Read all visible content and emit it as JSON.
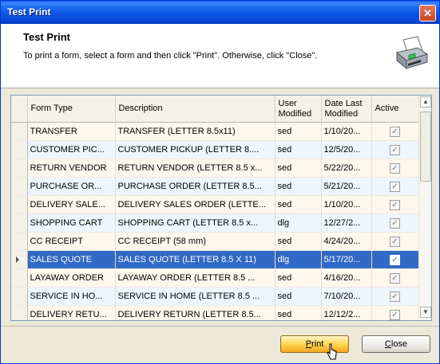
{
  "window": {
    "title": "Test Print",
    "close_glyph": "✕"
  },
  "header": {
    "title": "Test Print",
    "description": "To print a form, select a form and then click \"Print\".  Otherwise, click \"Close\".",
    "icon": "printer-icon"
  },
  "grid": {
    "columns": [
      "Form Type",
      "Description",
      "User Modified",
      "Date Last Modified",
      "Active"
    ],
    "rows": [
      {
        "form_type": "TRANSFER",
        "description": "TRANSFER (LETTER 8.5x11)",
        "user": "sed",
        "date": "1/10/20...",
        "active": true
      },
      {
        "form_type": "CUSTOMER PIC...",
        "description": "CUSTOMER PICKUP (LETTER 8....",
        "user": "sed",
        "date": "12/5/20...",
        "active": true
      },
      {
        "form_type": "RETURN VENDOR",
        "description": "RETURN VENDOR (LETTER 8.5 x...",
        "user": "sed",
        "date": "5/22/20...",
        "active": true
      },
      {
        "form_type": "PURCHASE OR...",
        "description": "PURCHASE ORDER (LETTER 8.5...",
        "user": "sed",
        "date": "5/21/20...",
        "active": true
      },
      {
        "form_type": "DELIVERY SALE...",
        "description": "DELIVERY SALES ORDER (LETTE...",
        "user": "sed",
        "date": "1/10/20...",
        "active": true
      },
      {
        "form_type": "SHOPPING CART",
        "description": "SHOPPING CART (LETTER 8.5 x...",
        "user": "dlg",
        "date": "12/27/2...",
        "active": true
      },
      {
        "form_type": "CC RECEIPT",
        "description": "CC RECEIPT (58 mm)",
        "user": "sed",
        "date": "4/24/20...",
        "active": true
      },
      {
        "form_type": "SALES QUOTE",
        "description": "SALES QUOTE (LETTER 8.5 X 11)",
        "user": "dlg",
        "date": "5/17/20...",
        "active": true,
        "selected": true
      },
      {
        "form_type": "LAYAWAY ORDER",
        "description": "LAYAWAY ORDER (LETTER 8.5 ...",
        "user": "sed",
        "date": "4/16/20...",
        "active": true
      },
      {
        "form_type": "SERVICE IN HO...",
        "description": "SERVICE IN HOME (LETTER 8.5 ...",
        "user": "sed",
        "date": "7/10/20...",
        "active": true
      },
      {
        "form_type": "DELIVERY RETU...",
        "description": "DELIVERY RETURN (LETTER 8.5...",
        "user": "sed",
        "date": "12/12/2...",
        "active": true
      }
    ]
  },
  "buttons": {
    "print": {
      "accel": "P",
      "rest": "rint"
    },
    "close": {
      "accel": "C",
      "rest": "lose"
    }
  },
  "colors": {
    "selection": "#316ac5",
    "titlebar": "#0a5bf0"
  }
}
